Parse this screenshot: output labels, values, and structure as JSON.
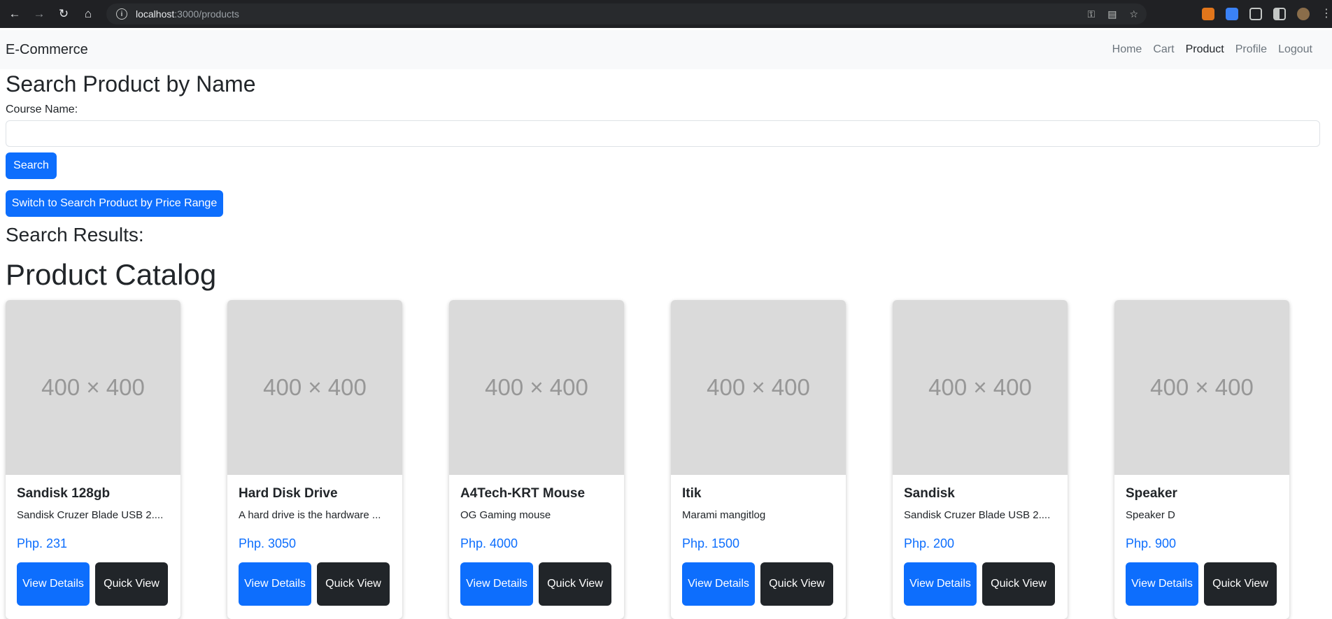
{
  "browser": {
    "url_host": "localhost",
    "url_path": ":3000/products"
  },
  "navbar": {
    "brand": "E-Commerce",
    "links": [
      {
        "label": "Home"
      },
      {
        "label": "Cart"
      },
      {
        "label": "Product"
      },
      {
        "label": "Profile"
      },
      {
        "label": "Logout"
      }
    ],
    "active_link": "Product"
  },
  "search": {
    "title": "Search Product by Name",
    "field_label": "Course Name:",
    "input_value": "",
    "search_button": "Search",
    "switch_button": "Switch to Search Product by Price Range",
    "results_heading": "Search Results:"
  },
  "catalog": {
    "title": "Product Catalog",
    "placeholder_text": "400 × 400",
    "view_details_label": "View Details",
    "quick_view_label": "Quick View",
    "products": [
      {
        "name": "Sandisk 128gb",
        "description": "Sandisk Cruzer Blade USB 2....",
        "price": "Php. 231"
      },
      {
        "name": "Hard Disk Drive",
        "description": "A hard drive is the hardware ...",
        "price": "Php. 3050"
      },
      {
        "name": "A4Tech-KRT Mouse",
        "description": "OG Gaming mouse",
        "price": "Php. 4000"
      },
      {
        "name": "Itik",
        "description": "Marami mangitlog",
        "price": "Php. 1500"
      },
      {
        "name": "Sandisk",
        "description": "Sandisk Cruzer Blade USB 2....",
        "price": "Php. 200"
      },
      {
        "name": "Speaker",
        "description": "Speaker D",
        "price": "Php. 900"
      }
    ]
  },
  "colors": {
    "primary": "#0d6efd",
    "dark": "#212529",
    "navbar_bg": "#f8f9fa",
    "placeholder_bg": "#dadada"
  }
}
